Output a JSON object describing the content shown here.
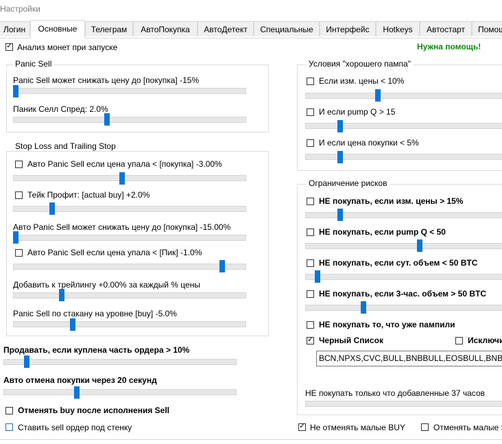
{
  "window": {
    "title": "Настройки"
  },
  "tabs": [
    {
      "label": "Логин"
    },
    {
      "label": "Основные",
      "active": true
    },
    {
      "label": "Телеграм"
    },
    {
      "label": "АвтоПокупка"
    },
    {
      "label": "АвтоДетект"
    },
    {
      "label": "Специальные"
    },
    {
      "label": "Интерфейс"
    },
    {
      "label": "Hotkeys"
    },
    {
      "label": "Автостарт"
    },
    {
      "label": "Помощь"
    }
  ],
  "top": {
    "analyze_label": "Анализ монет при запуске",
    "analyze_checked": true,
    "help_link": "Нужна помощь!"
  },
  "panic_sell": {
    "title": "Panic Sell",
    "limit_label": "Panic Sell может снижать цену до [покупка] -15%",
    "limit_level": 0.0,
    "spread_label": "Паник Селл Спред: 2.0%",
    "spread_level": 0.4
  },
  "stop_loss": {
    "title": "Stop Loss and Trailing Stop",
    "auto_panic_label": "Авто Panic Sell если цена упала < [покупка] -3.00%",
    "auto_panic_checked": false,
    "auto_panic_level": 0.47,
    "take_profit_label": "Тейк Профит: [actual buy] +2.0%",
    "take_profit_checked": false,
    "take_profit_level": 0.17,
    "auto_limit_label": "Авто Panic Sell может снижать цену до [покупка] -15.00%",
    "auto_limit_level": 0.0,
    "peak_label": "Авто Panic Sell если цена упала < [Пик] -1.0%",
    "peak_checked": false,
    "peak_level": 0.88,
    "trailing_label": "Добавить к трейлингу +0.00% за каждый % цены",
    "trailing_level": 0.21,
    "orderbook_label": "Panic Sell по стакану на уровне [buy] -5.0%",
    "orderbook_level": 0.25
  },
  "bottom_left": {
    "sell_partial_label": "Продавать, если куплена часть ордера > 10%",
    "sell_partial_level": 0.1,
    "auto_cancel_label": "Авто отмена покупки через 20 секунд",
    "auto_cancel_level": 0.31,
    "cancel_buy_label": "Отменять buy после исполнения Sell",
    "cancel_buy_checked": false,
    "wall_label": "Ставить sell ордер под стенку",
    "wall_checked": false
  },
  "good_pump": {
    "title": "Условия \"хорошего пампа\"",
    "price_change_label": "Если изм. цены < 10%",
    "price_change_checked": false,
    "price_change_level": 0.37,
    "pump_q_label": "И если pump Q > 15",
    "pump_q_checked": false,
    "pump_q_level": 0.17,
    "buy_price_label": "И если цена покупки < 5%",
    "buy_price_checked": false,
    "buy_price_level": 0.17
  },
  "risk": {
    "title": "Ограничение рисков",
    "no_buy_price_label": "НЕ покупать, если изм. цены  > 15%",
    "no_buy_price_checked": false,
    "no_buy_price_level": 0.17,
    "no_buy_pump_label": "НЕ покупать, если pump Q < 50",
    "no_buy_pump_checked": false,
    "no_buy_pump_level": 0.58,
    "no_buy_day_vol_label": "НЕ покупать, если сут. объем < 50 BTC",
    "no_buy_day_vol_checked": false,
    "no_buy_day_vol_level": 0.05,
    "no_buy_3h_vol_label": "НЕ покупать, если 3-час. объем > 50 BTC",
    "no_buy_3h_vol_checked": false,
    "no_buy_3h_vol_level": 0.29,
    "no_pumped_label": "НЕ покупать то, что уже пампили",
    "no_pumped_checked": false,
    "blacklist_label": "Черный Список",
    "blacklist_checked": true,
    "exclude_label": "Исключи",
    "exclude_checked": false,
    "blacklist_value": "BCN,NPXS,CVC,BULL,BNBBULL,EOSBULL,BNBBEAR,",
    "recent_label": "НЕ покупать только что добавленные 37 часов",
    "recent_level": 0.0
  },
  "bottom_right": {
    "no_cancel_small_label": "Не отменять малые BUY",
    "no_cancel_small_checked": true,
    "cancel_small_label": "Отменять малые S",
    "cancel_small_checked": false
  }
}
